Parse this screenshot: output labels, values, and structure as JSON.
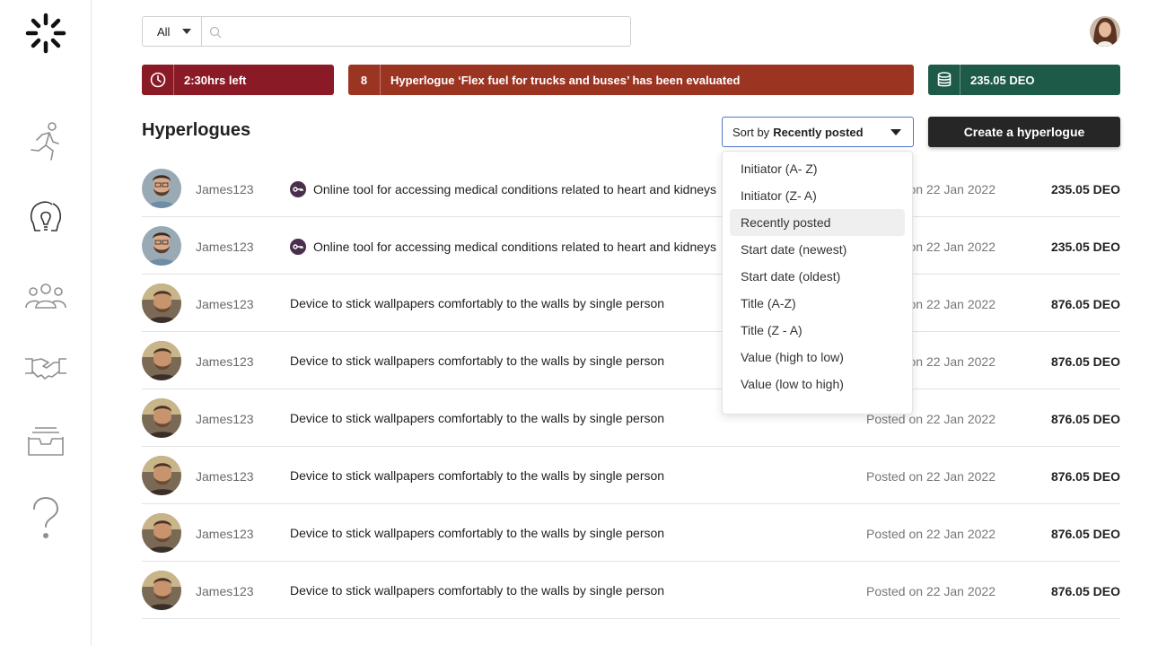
{
  "app": {
    "logo_icon": "sunburst-logo-icon"
  },
  "sidebar": {
    "items": [
      {
        "icon": "runner-icon"
      },
      {
        "icon": "head-lightbulb-icon"
      },
      {
        "icon": "people-group-icon"
      },
      {
        "icon": "handshake-icon"
      },
      {
        "icon": "inbox-tray-icon"
      },
      {
        "icon": "question-mark-icon"
      }
    ]
  },
  "search": {
    "filter_value": "All",
    "value": "",
    "placeholder": ""
  },
  "banners": {
    "time": {
      "icon": "clock-icon",
      "text": "2:30hrs left",
      "color": "#8a1a25"
    },
    "notification": {
      "count": "8",
      "text": "Hyperlogue ‘Flex fuel for trucks and buses’ has been evaluated",
      "color": "#9c3422"
    },
    "wallet": {
      "icon": "coin-stack-icon",
      "text": "235.05 DEO",
      "color": "#1e5a48"
    }
  },
  "main": {
    "title": "Hyperlogues",
    "sort": {
      "prefix": "Sort by",
      "selected": "Recently posted",
      "options": [
        "Initiator (A- Z)",
        "Initiator (Z- A)",
        "Recently posted",
        "Start date (newest)",
        "Start date (oldest)",
        "Title (A-Z)",
        "Title (Z - A)",
        "Value (high to low)",
        "Value (low to high)"
      ]
    },
    "create_label": "Create a hyperlogue",
    "rows": [
      {
        "user": "James123",
        "title": "Online tool for accessing medical conditions related to heart and kidneys",
        "posted": "Posted on 22 Jan 2022",
        "value": "235.05 DEO",
        "locked": true
      },
      {
        "user": "James123",
        "title": "Online tool for accessing medical conditions related to heart and kidneys",
        "posted": "Posted on 22 Jan 2022",
        "value": "235.05 DEO",
        "locked": true
      },
      {
        "user": "James123",
        "title": "Device to stick wallpapers comfortably to the walls by single person",
        "posted": "Posted on 22 Jan 2022",
        "value": "876.05 DEO",
        "locked": false
      },
      {
        "user": "James123",
        "title": "Device to stick wallpapers comfortably to the walls by single person",
        "posted": "Posted on 22 Jan 2022",
        "value": "876.05 DEO",
        "locked": false
      },
      {
        "user": "James123",
        "title": "Device to stick wallpapers comfortably to the walls by single person",
        "posted": "Posted on 22 Jan 2022",
        "value": "876.05 DEO",
        "locked": false
      },
      {
        "user": "James123",
        "title": "Device to stick wallpapers comfortably to the walls by single person",
        "posted": "Posted on 22 Jan 2022",
        "value": "876.05 DEO",
        "locked": false
      },
      {
        "user": "James123",
        "title": "Device to stick wallpapers comfortably to the walls by single person",
        "posted": "Posted on 22 Jan 2022",
        "value": "876.05 DEO",
        "locked": false
      },
      {
        "user": "James123",
        "title": "Device to stick wallpapers comfortably to the walls by single person",
        "posted": "Posted on 22 Jan 2022",
        "value": "876.05 DEO",
        "locked": false
      }
    ]
  }
}
